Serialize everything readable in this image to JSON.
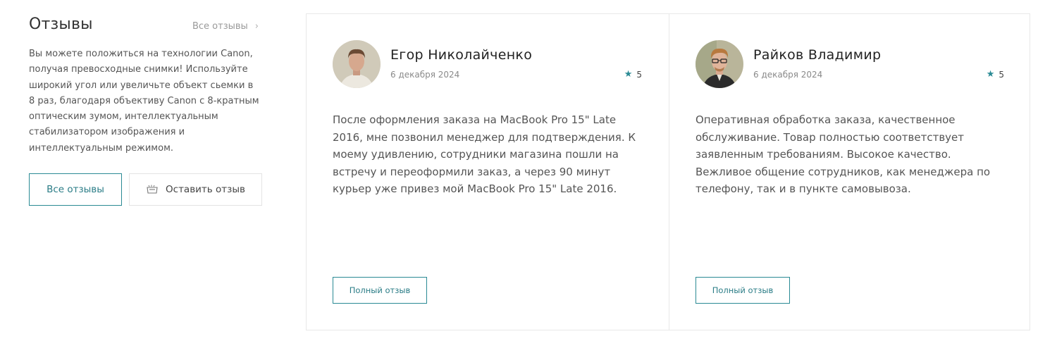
{
  "sidebar": {
    "title": "Отзывы",
    "all_link": "Все отзывы",
    "description": "Вы можете положиться на технологии Canon, получая превосходные снимки! Используйте широкий угол или увеличьте объект сьемки в 8 раз, благодаря объективу Canon с 8-кратным оптическим зумом, интеллектуальным стабилизатором изображения и интеллектуальным режимом.",
    "btn_all": "Все отзывы",
    "btn_leave": "Оставить отзыв"
  },
  "reviews": [
    {
      "author": "Егор Николайченко",
      "date": "6 декабря 2024",
      "rating": "5",
      "text": "После оформления заказа на MacBook Pro 15\" Late 2016, мне позвонил менеджер для подтверждения. К моему удивлению, сотрудники магазина пошли на встречу и переоформили заказ, а через 90 минут курьер уже привез мой MacBook Pro 15\" Late 2016.",
      "button": "Полный отзыв"
    },
    {
      "author": "Райков Владимир",
      "date": "6 декабря 2024",
      "rating": "5",
      "text": "Оперативная обработка заказа, качественное обслуживание. Товар полностью соответствует заявленным требованиям. Высокое качество. Вежливое общение сотрудников, как менеджера по телефону, так и в пункте самовывоза.",
      "button": "Полный отзыв"
    }
  ],
  "colors": {
    "accent": "#2a8a94",
    "border": "#e8e8e8"
  },
  "icons": {
    "all_link": "chevron-right-icon",
    "leave_button": "pencil-icon",
    "rating": "star-icon"
  }
}
